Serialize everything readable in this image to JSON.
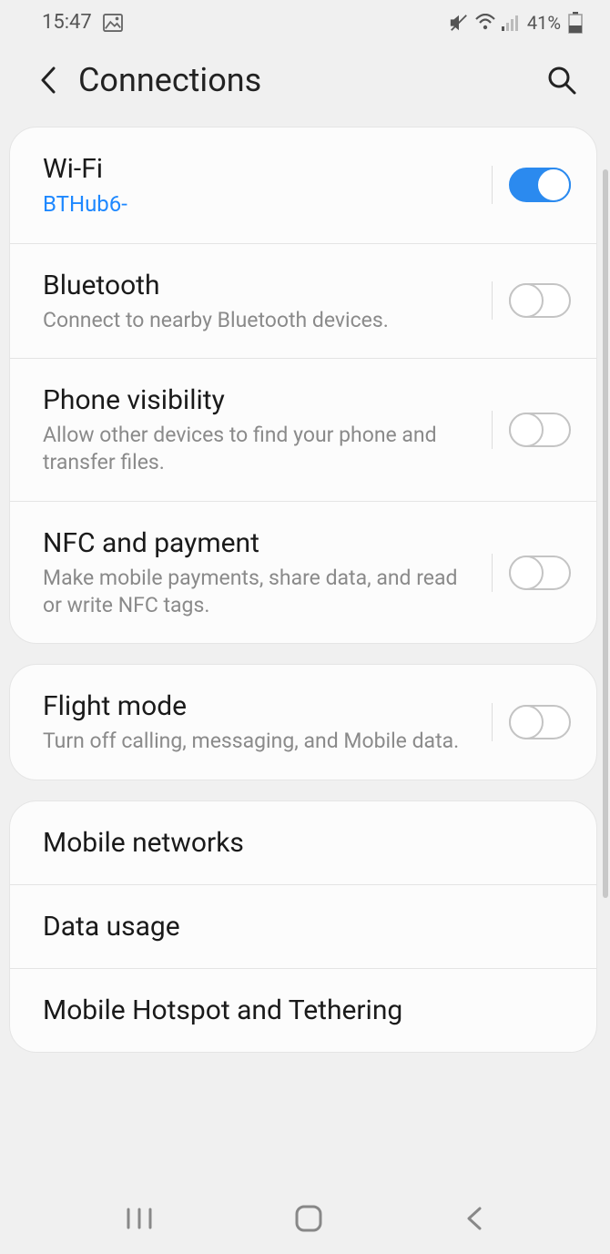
{
  "status": {
    "time": "15:47",
    "battery": "41%"
  },
  "header": {
    "title": "Connections"
  },
  "group1": {
    "wifi": {
      "title": "Wi-Fi",
      "sub": "BTHub6-",
      "on": true
    },
    "bluetooth": {
      "title": "Bluetooth",
      "sub": "Connect to nearby Bluetooth devices."
    },
    "visibility": {
      "title": "Phone visibility",
      "sub": "Allow other devices to find your phone and transfer files."
    },
    "nfc": {
      "title": "NFC and payment",
      "sub": "Make mobile payments, share data, and read or write NFC tags."
    }
  },
  "group2": {
    "flight": {
      "title": "Flight mode",
      "sub": "Turn off calling, messaging, and Mobile data."
    }
  },
  "group3": {
    "mobile_networks": {
      "title": "Mobile networks"
    },
    "data_usage": {
      "title": "Data usage"
    },
    "hotspot": {
      "title": "Mobile Hotspot and Tethering"
    }
  }
}
